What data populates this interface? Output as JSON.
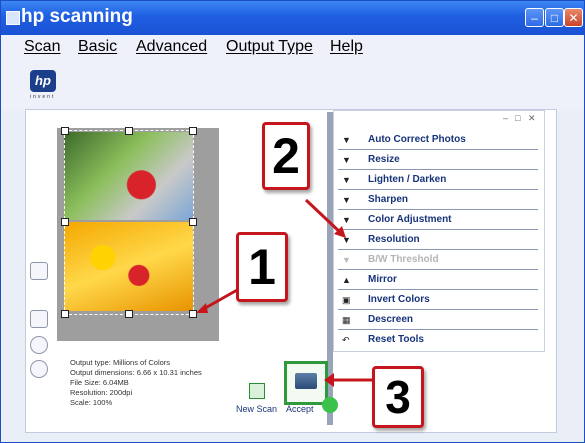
{
  "window": {
    "title": "hp scanning",
    "min_icon": "minimize-icon",
    "max_icon": "maximize-icon",
    "close_icon": "close-icon"
  },
  "menu": [
    {
      "label": "Scan"
    },
    {
      "label": "Basic"
    },
    {
      "label": "Advanced"
    },
    {
      "label": "Output Type"
    },
    {
      "label": "Help"
    }
  ],
  "logo": {
    "text": "hp",
    "tagline": "invent"
  },
  "tools": [
    {
      "label": "Auto Correct Photos",
      "icon": "triangle-down-icon",
      "enabled": true
    },
    {
      "label": "Resize",
      "icon": "triangle-down-icon",
      "enabled": true
    },
    {
      "label": "Lighten / Darken",
      "icon": "triangle-down-icon",
      "enabled": true
    },
    {
      "label": "Sharpen",
      "icon": "triangle-down-icon",
      "enabled": true
    },
    {
      "label": "Color Adjustment",
      "icon": "triangle-down-icon",
      "enabled": true
    },
    {
      "label": "Resolution",
      "icon": "triangle-down-icon",
      "enabled": true
    },
    {
      "label": "B/W Threshold",
      "icon": "triangle-down-icon",
      "enabled": false
    },
    {
      "label": "Mirror",
      "icon": "mirror-icon",
      "enabled": true
    },
    {
      "label": "Invert Colors",
      "icon": "invert-icon",
      "enabled": true
    },
    {
      "label": "Descreen",
      "icon": "descreen-icon",
      "enabled": true
    },
    {
      "label": "Reset Tools",
      "icon": "reset-icon",
      "enabled": true
    }
  ],
  "info": {
    "output_type": "Output type: Millions of Colors",
    "dimensions": "Output dimensions: 6.66 x 10.31 inches",
    "file_size": "File Size: 6.04MB",
    "resolution": "Resolution:  200dpi",
    "scale": "Scale: 100%"
  },
  "buttons": {
    "new_scan": "New Scan",
    "accept": "Accept"
  },
  "callouts": [
    "1",
    "2",
    "3"
  ],
  "colors": {
    "titlebar": "#1f5ee2",
    "callout_border": "#c4161c",
    "accept_border": "#2f9a3b"
  }
}
